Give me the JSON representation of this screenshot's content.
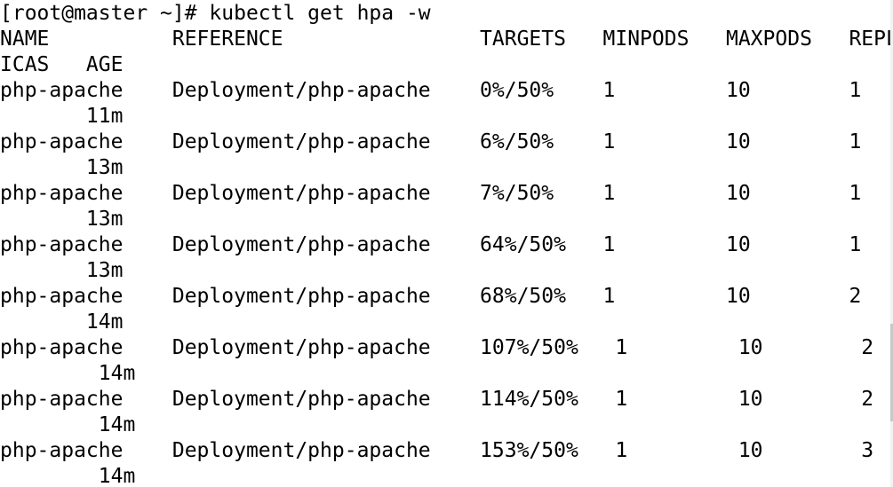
{
  "terminal": {
    "lines": [
      "[root@master ~]# kubectl get hpa -w",
      "NAME          REFERENCE                TARGETS   MINPODS   MAXPODS   REPL",
      "ICAS   AGE",
      "php-apache    Deployment/php-apache    0%/50%    1         10        1",
      "       11m",
      "php-apache    Deployment/php-apache    6%/50%    1         10        1",
      "       13m",
      "php-apache    Deployment/php-apache    7%/50%    1         10        1",
      "       13m",
      "php-apache    Deployment/php-apache    64%/50%   1         10        1",
      "       13m",
      "php-apache    Deployment/php-apache    68%/50%   1         10        2",
      "       14m",
      "php-apache    Deployment/php-apache    107%/50%   1         10        2",
      "        14m",
      "php-apache    Deployment/php-apache    114%/50%   1         10        2",
      "        14m",
      "php-apache    Deployment/php-apache    153%/50%   1         10        3",
      "        14m"
    ]
  }
}
